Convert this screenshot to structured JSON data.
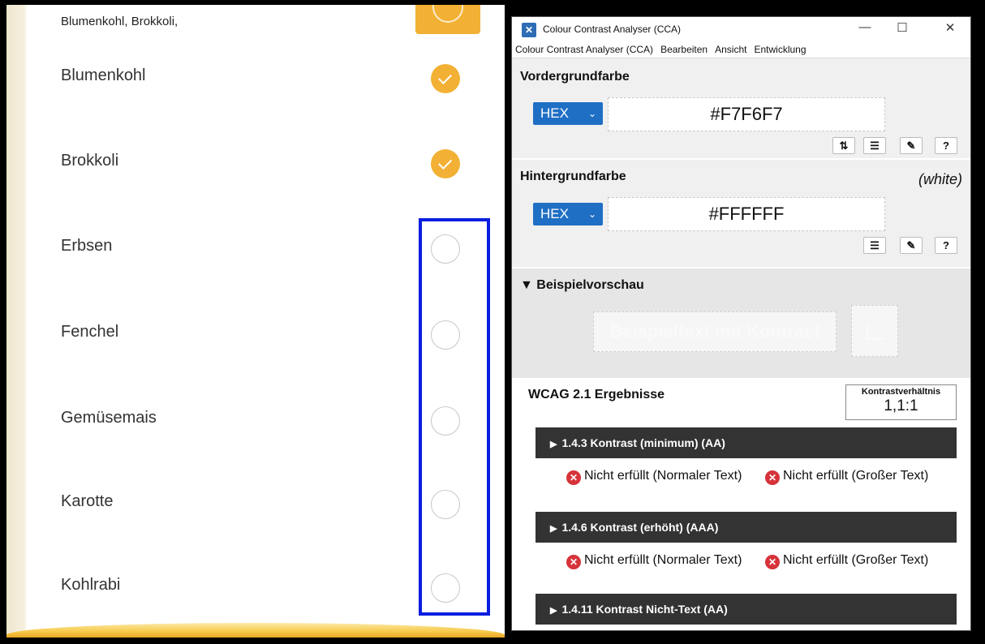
{
  "left_app": {
    "summary_text": "Blumenkohl, Brokkoli,",
    "items": [
      {
        "label": "Blumenkohl",
        "checked": true
      },
      {
        "label": "Brokkoli",
        "checked": true
      },
      {
        "label": "Erbsen",
        "checked": false
      },
      {
        "label": "Fenchel",
        "checked": false
      },
      {
        "label": "Gemüsemais",
        "checked": false
      },
      {
        "label": "Karotte",
        "checked": false
      },
      {
        "label": "Kohlrabi",
        "checked": false
      }
    ],
    "accent_color": "#f2b134",
    "highlight_color": "#0a1ee0"
  },
  "cca": {
    "title": "Colour Contrast Analyser (CCA)",
    "window_controls": {
      "minimize": "—",
      "maximize": "☐",
      "close": "✕"
    },
    "menu": [
      "Colour Contrast Analyser (CCA)",
      "Bearbeiten",
      "Ansicht",
      "Entwicklung"
    ],
    "foreground": {
      "title": "Vordergrundfarbe",
      "format": "HEX",
      "value": "#F7F6F7",
      "tools": [
        "swap-icon",
        "sliders-icon",
        "eyedropper-icon",
        "help-icon"
      ]
    },
    "background": {
      "title": "Hintergrundfarbe",
      "named_color": "(white)",
      "format": "HEX",
      "value": "#FFFFFF",
      "tools": [
        "sliders-icon",
        "eyedropper-icon",
        "help-icon"
      ]
    },
    "preview": {
      "title": "Beispielvorschau",
      "sample_text": "Beispieltext mit Kontrast"
    },
    "wcag": {
      "title": "WCAG 2.1 Ergebnisse",
      "ratio_label": "Kontrastverhältnis",
      "ratio_value": "1,1:1",
      "criteria": [
        {
          "label": "1.4.3 Kontrast (minimum) (AA)",
          "normal": "Nicht erfüllt (Normaler Text)",
          "large": "Nicht erfüllt (Großer Text)"
        },
        {
          "label": "1.4.6 Kontrast (erhöht) (AAA)",
          "normal": "Nicht erfüllt (Normaler Text)",
          "large": "Nicht erfüllt (Großer Text)"
        },
        {
          "label": "1.4.11 Kontrast Nicht-Text (AA)"
        }
      ]
    }
  }
}
